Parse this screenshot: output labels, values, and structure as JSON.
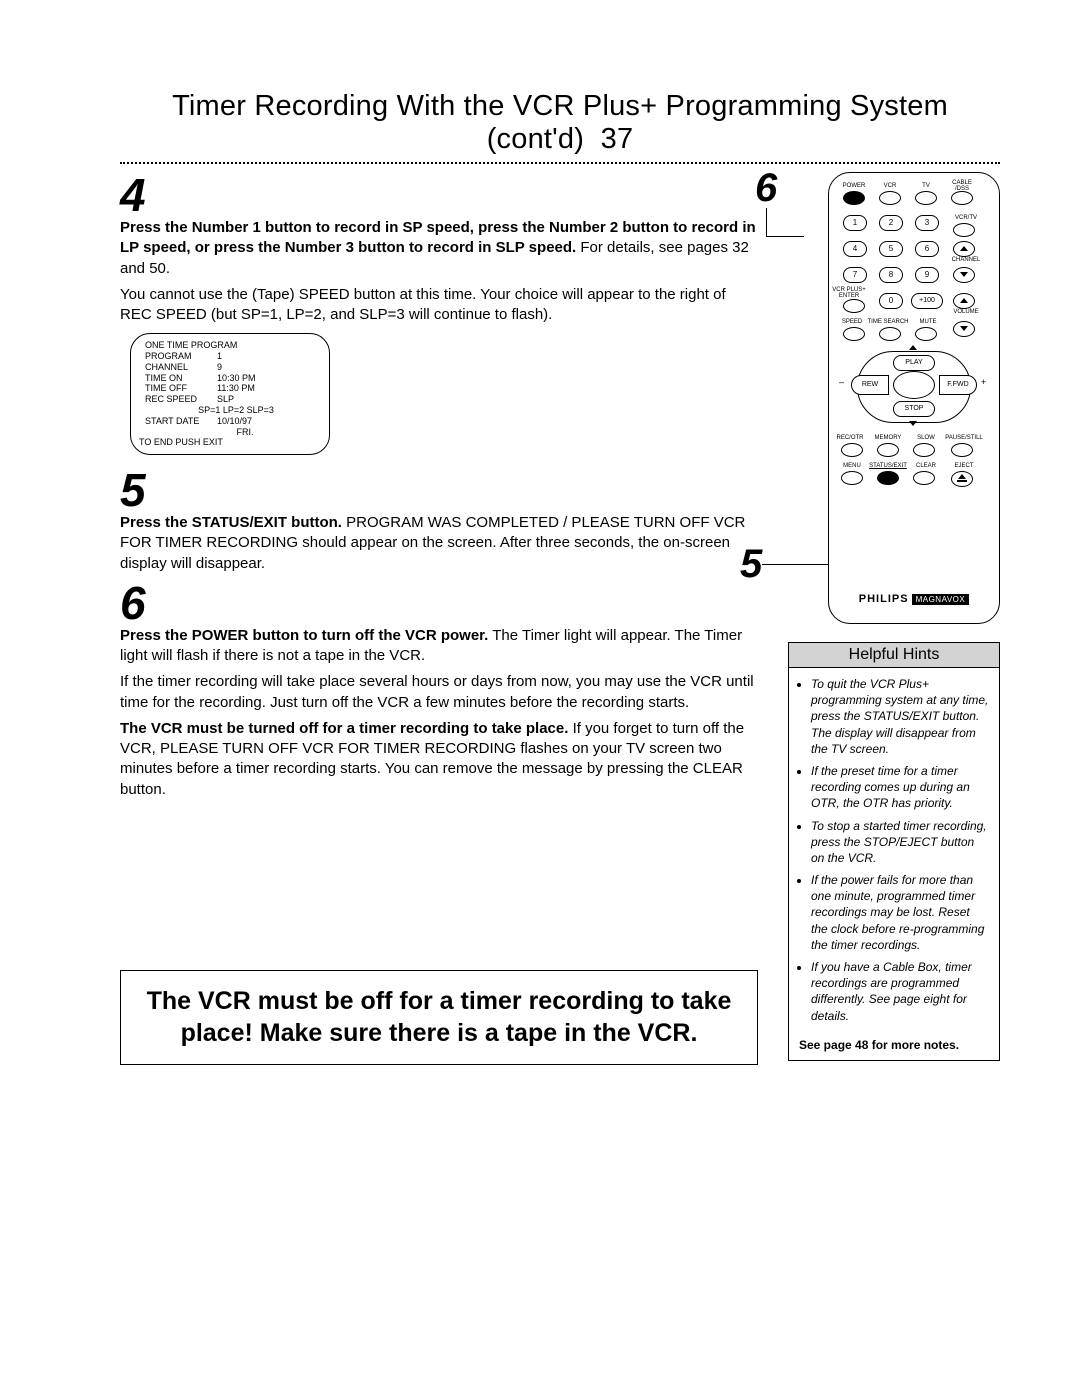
{
  "page": {
    "title": "Timer Recording With the VCR Plus+ Programming System (cont'd)",
    "number": "37"
  },
  "steps": {
    "s4": {
      "num": "4",
      "bold": "Press the Number 1 button to record in SP speed, press the Number 2 button to record in LP speed, or press the Number 3 button to record in SLP speed.",
      "rest": " For details, see pages 32 and 50.",
      "p2": "You cannot use the (Tape) SPEED button at this time. Your choice will appear to the right of REC SPEED (but SP=1, LP=2, and SLP=3 will continue to flash)."
    },
    "s5": {
      "num": "5",
      "bold": "Press the STATUS/EXIT button.",
      "rest": " PROGRAM WAS COMPLETED / PLEASE TURN OFF VCR FOR TIMER RECORDING should appear on the screen.  After three seconds, the on-screen display will disappear."
    },
    "s6": {
      "num": "6",
      "bold1": "Press the POWER button to turn off the VCR power.",
      "rest1": " The Timer light will appear. The Timer light will flash if there is not a tape in the VCR.",
      "p2": "If the timer recording will take place several hours or days from now, you may use the VCR until time for the recording. Just turn off the VCR a few minutes before the recording starts.",
      "bold3": "The VCR must be turned off for a timer recording to take place.",
      "rest3": " If you forget to turn off the VCR, PLEASE TURN OFF VCR FOR TIMER RECORDING flashes on your TV screen two minutes before a timer recording starts. You can remove the message by pressing the CLEAR button."
    }
  },
  "osd": {
    "title": "ONE TIME PROGRAM",
    "rows": [
      {
        "k": "PROGRAM",
        "v": "1"
      },
      {
        "k": "CHANNEL",
        "v": "9"
      },
      {
        "k": "TIME ON",
        "v": "10:30 PM"
      },
      {
        "k": "TIME OFF",
        "v": "11:30 PM"
      },
      {
        "k": "REC SPEED",
        "v": "SLP"
      }
    ],
    "speeds": "SP=1   LP=2   SLP=3",
    "date_k": "START DATE",
    "date_v": "10/10/97",
    "day": "FRI.",
    "exit": "TO END PUSH EXIT"
  },
  "callout": {
    "text": "The VCR must be off for a timer recording to take place!  Make sure there is a tape in the VCR."
  },
  "remote": {
    "top_labels": [
      "POWER",
      "VCR",
      "TV",
      "CABLE /DSS"
    ],
    "side_labels": {
      "vcrtv": "VCR/TV",
      "channel": "CHANNEL",
      "enter": "VCR PLUS+ ENTER",
      "volume": "VOLUME"
    },
    "row_labels": [
      "SPEED",
      "TIME SEARCH",
      "MUTE"
    ],
    "transport": {
      "play": "PLAY",
      "rew": "REW",
      "ffwd": "F.FWD",
      "stop": "STOP"
    },
    "plusminus": {
      "minus": "–",
      "plus": "+"
    },
    "bottom_labels_a": [
      "REC/OTR",
      "MEMORY",
      "SLOW",
      "PAUSE/STILL"
    ],
    "bottom_labels_b": [
      "MENU",
      "STATUS/EXIT",
      "CLEAR",
      "EJECT"
    ],
    "brand": {
      "p": "PHILIPS",
      "m": "MAGNAVOX"
    },
    "numpad": [
      "1",
      "2",
      "3",
      "4",
      "5",
      "6",
      "7",
      "8",
      "9",
      "0",
      "+100"
    ]
  },
  "callouts": {
    "c6": "6",
    "c4": "4",
    "c5": "5"
  },
  "hints": {
    "title": "Helpful Hints",
    "items": [
      "To quit the VCR Plus+ programming system at any time, press the STATUS/EXIT button. The display will disappear from the TV screen.",
      "If the preset time for a timer recording comes up during an OTR, the OTR has priority.",
      "To stop a started timer recording, press the STOP/EJECT button on the VCR.",
      "If the power fails for more than one minute, programmed timer recordings may be lost. Reset the clock before re-programming the timer recordings.",
      "If you have a Cable Box, timer recordings are programmed differently. See page eight for details."
    ],
    "foot": "See page 48 for more notes."
  }
}
